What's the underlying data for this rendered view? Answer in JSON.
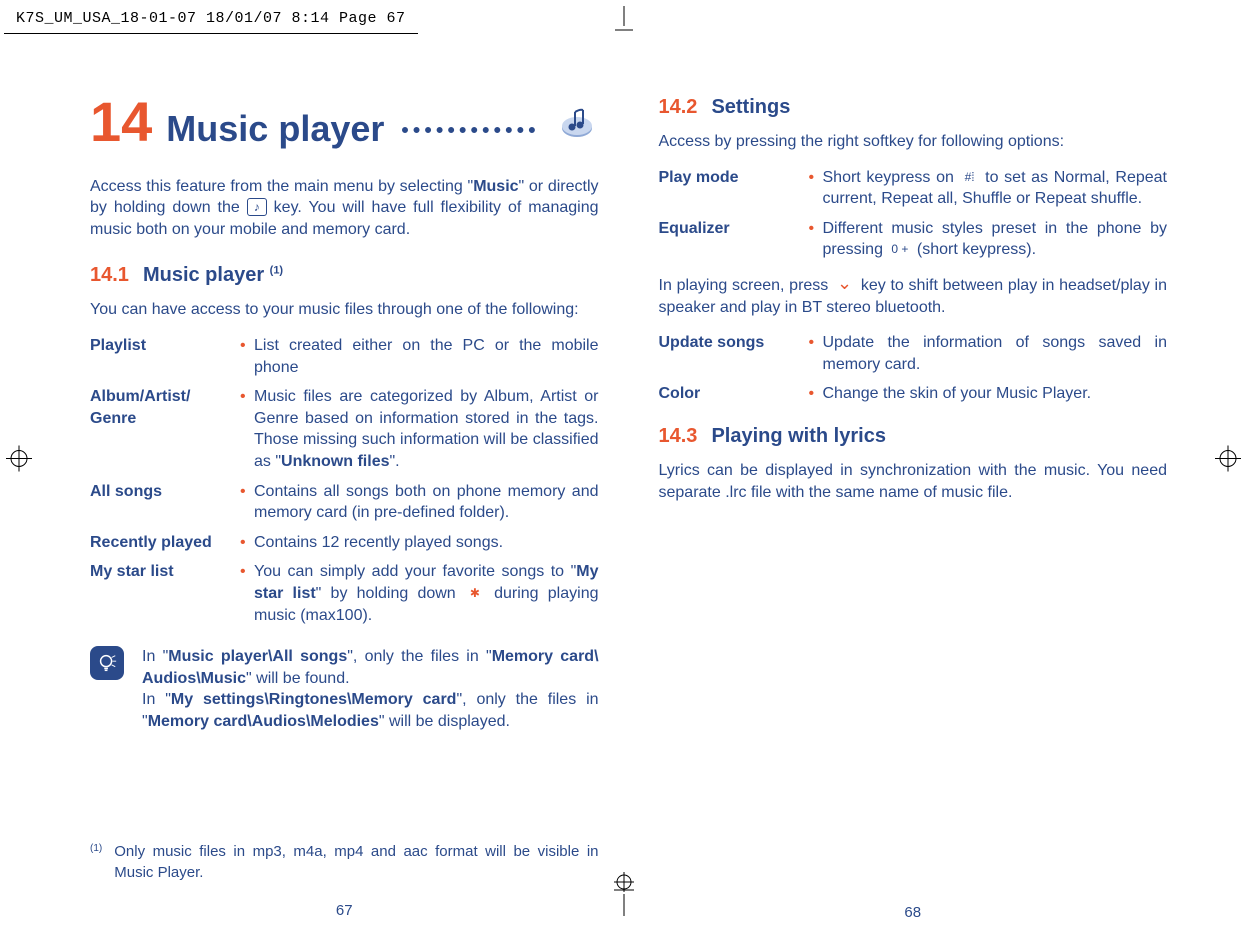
{
  "header": "K7S_UM_USA_18-01-07  18/01/07  8:14  Page 67",
  "left": {
    "chapter_num": "14",
    "chapter_name": "Music player",
    "intro_parts": [
      "Access this feature from the main menu by selecting \"",
      "Music",
      "\" or directly by holding down the ",
      " key. You will have full flexibility of managing music both on your mobile and memory card."
    ],
    "sec1_num": "14.1",
    "sec1_title": "Music player ",
    "sec1_sup": "(1)",
    "sec1_lead": "You can have access to your music files through one of the following:",
    "rows": [
      {
        "term": "Playlist",
        "desc_plain": "List created either on the PC or the mobile phone"
      },
      {
        "term": "Album/Artist/\nGenre",
        "desc_parts": [
          "Music files are categorized by Album, Artist or Genre based on information stored in the tags. Those missing such information will be classified as \"",
          "Unknown files",
          "\"."
        ]
      },
      {
        "term": "All songs",
        "desc_plain": "Contains all songs both on phone memory and memory card (in pre-defined folder)."
      },
      {
        "term": "Recently played",
        "desc_plain": "Contains 12 recently played songs."
      },
      {
        "term": "My star list",
        "desc_parts": [
          "You can simply add your favorite songs to \"",
          "My star list",
          "\" by holding down ",
          " during playing music (max100)."
        ]
      }
    ],
    "tip_parts": [
      "In \"",
      "Music player\\All songs",
      "\", only the files in \"",
      "Memory card\\ Audios\\Music",
      "\" will be found.",
      "In \"",
      "My settings\\Ringtones\\Memory card",
      "\", only the files in \"",
      "Memory card\\Audios\\Melodies",
      "\" will be displayed."
    ],
    "footnote_mark": "(1)",
    "footnote_text": "Only music files in mp3, m4a, mp4 and aac format will be visible in Music Player.",
    "page_num": "67"
  },
  "right": {
    "sec2_num": "14.2",
    "sec2_title": "Settings",
    "sec2_lead": "Access by pressing the right softkey for following options:",
    "rows1": [
      {
        "term": "Play mode",
        "desc_parts": [
          "Short keypress on ",
          " to set as Normal, Repeat current, Repeat all, Shuffle or Repeat shuffle."
        ]
      },
      {
        "term": "Equalizer",
        "desc_parts": [
          "Different music styles preset in the phone by pressing ",
          " (short keypress)."
        ]
      }
    ],
    "mid_parts": [
      "In playing screen, press ",
      " key to shift between play in headset/play in speaker and play in BT stereo bluetooth."
    ],
    "rows2": [
      {
        "term": "Update songs",
        "desc_plain": "Update the information of songs saved in memory card."
      },
      {
        "term": "Color",
        "desc_plain": "Change the skin of your Music Player."
      }
    ],
    "sec3_num": "14.3",
    "sec3_title": "Playing with lyrics",
    "sec3_body": "Lyrics can be displayed in synchronization with the music. You need separate .lrc file with the same name of music file.",
    "page_num": "68"
  },
  "keys": {
    "music": "♪",
    "star": "✱",
    "hash": "#⁞",
    "zero": "0 +",
    "down": "⌄"
  }
}
